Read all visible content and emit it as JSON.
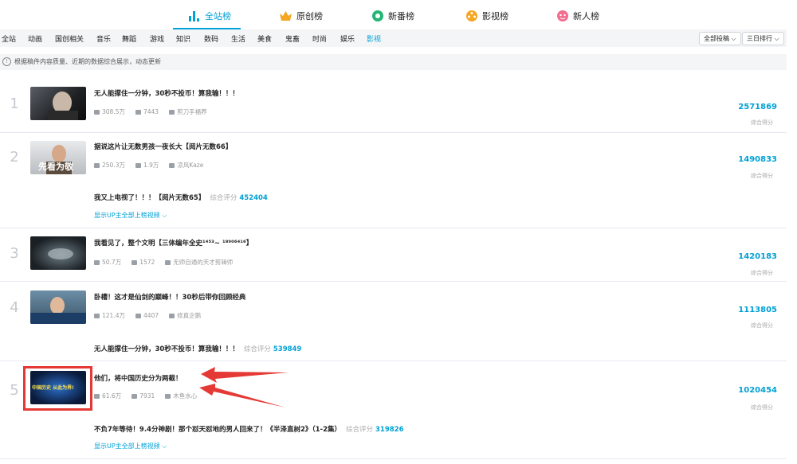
{
  "tabs": [
    {
      "label": "全站榜",
      "icon": "bar-chart-icon",
      "active": true
    },
    {
      "label": "原创榜",
      "icon": "crown-icon",
      "active": false
    },
    {
      "label": "新番榜",
      "icon": "circle-play-icon",
      "active": false
    },
    {
      "label": "影视榜",
      "icon": "film-reel-icon",
      "active": false
    },
    {
      "label": "新人榜",
      "icon": "mascot-icon",
      "active": false
    }
  ],
  "categories": [
    "全站",
    "动画",
    "国创相关",
    "音乐",
    "舞蹈",
    "游戏",
    "知识",
    "数码",
    "生活",
    "美食",
    "鬼畜",
    "时尚",
    "娱乐",
    "影视"
  ],
  "active_category": "影视",
  "filters": {
    "type": "全部投稿",
    "range": "三日排行"
  },
  "notice": "根据稿件内容质量、近期的数据综合展示，动态更新",
  "items": [
    {
      "rank": "1",
      "title": "无人能撑住一分钟，30秒不投币！算我输！！！",
      "plays": "308.5万",
      "danmaku": "7443",
      "author": "剪刀手福养",
      "score": "2571869",
      "score_label": "综合得分"
    },
    {
      "rank": "2",
      "title": "据说这片让无数男孩一夜长大【阅片无数66】",
      "plays": "250.3万",
      "danmaku": "1.9万",
      "author": "凉风Kaze",
      "score": "1490833",
      "score_label": "综合得分",
      "thumb_text": "先看为敬"
    },
    {
      "rank": "3",
      "title": "我看见了，整个文明【三体编年全史¹⁴⁵³~ ¹⁸⁹⁰⁶⁴¹⁶】",
      "plays": "50.7万",
      "danmaku": "1572",
      "author": "无师自通的天才剪辑师",
      "score": "1420183",
      "score_label": "综合得分"
    },
    {
      "rank": "4",
      "title": "卧槽！这才是仙剑的巅峰！！30秒后带你回顾经典",
      "plays": "121.4万",
      "danmaku": "4407",
      "author": "修真企鹅",
      "score": "1113805",
      "score_label": "综合得分"
    },
    {
      "rank": "5",
      "title": "他们，将中国历史分为两截！",
      "plays": "61.6万",
      "danmaku": "7931",
      "author": "木鱼水心",
      "score": "1020454",
      "score_label": "综合得分",
      "thumb_text": "中国历史 从此为界!"
    }
  ],
  "sub_items": [
    {
      "title": "我又上电视了！！！【阅片无数65】",
      "label": "综合评分",
      "score": "452404"
    },
    {
      "title": "无人能撑住一分钟，30秒不投币！算我输！！！",
      "label": "综合评分",
      "score": "539849"
    },
    {
      "title": "不负7年等待！9.4分神剧！那个怼天怼地的男人回来了！《半泽直树2》（1-2集）",
      "label": "综合评分",
      "score": "319826"
    }
  ],
  "show_more": "显示UP主全部上榜视频",
  "colors": {
    "accent": "#00a1d6",
    "annotation": "#e53935"
  }
}
